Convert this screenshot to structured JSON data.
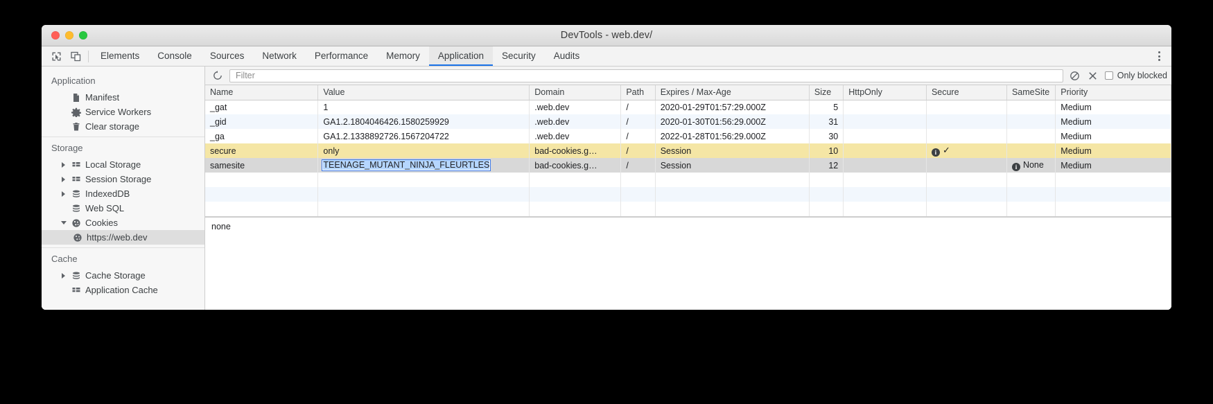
{
  "window": {
    "title": "DevTools - web.dev/",
    "traffic_lights": [
      "close",
      "minimize",
      "maximize"
    ]
  },
  "tabstrip": {
    "icons": [
      "inspect-element-icon",
      "device-toolbar-icon"
    ],
    "tabs": [
      {
        "label": "Elements",
        "active": false
      },
      {
        "label": "Console",
        "active": false
      },
      {
        "label": "Sources",
        "active": false
      },
      {
        "label": "Network",
        "active": false
      },
      {
        "label": "Performance",
        "active": false
      },
      {
        "label": "Memory",
        "active": false
      },
      {
        "label": "Application",
        "active": true
      },
      {
        "label": "Security",
        "active": false
      },
      {
        "label": "Audits",
        "active": false
      }
    ],
    "more_label": "more-options"
  },
  "sidebar": {
    "sections": [
      {
        "title": "Application",
        "items": [
          {
            "label": "Manifest",
            "icon": "document-icon",
            "twisty": "none",
            "indent": 1,
            "selected": false
          },
          {
            "label": "Service Workers",
            "icon": "gear-icon",
            "twisty": "none",
            "indent": 1,
            "selected": false
          },
          {
            "label": "Clear storage",
            "icon": "trash-icon",
            "twisty": "none",
            "indent": 1,
            "selected": false
          }
        ]
      },
      {
        "title": "Storage",
        "items": [
          {
            "label": "Local Storage",
            "icon": "table-icon",
            "twisty": "closed",
            "indent": 1,
            "selected": false
          },
          {
            "label": "Session Storage",
            "icon": "table-icon",
            "twisty": "closed",
            "indent": 1,
            "selected": false
          },
          {
            "label": "IndexedDB",
            "icon": "database-icon",
            "twisty": "closed",
            "indent": 1,
            "selected": false
          },
          {
            "label": "Web SQL",
            "icon": "database-icon",
            "twisty": "none",
            "indent": 1,
            "selected": false
          },
          {
            "label": "Cookies",
            "icon": "cookie-icon",
            "twisty": "open",
            "indent": 1,
            "selected": false
          },
          {
            "label": "https://web.dev",
            "icon": "cookie-icon",
            "twisty": "none",
            "indent": 2,
            "selected": true
          }
        ]
      },
      {
        "title": "Cache",
        "items": [
          {
            "label": "Cache Storage",
            "icon": "database-icon",
            "twisty": "closed",
            "indent": 1,
            "selected": false
          },
          {
            "label": "Application Cache",
            "icon": "table-icon",
            "twisty": "none",
            "indent": 1,
            "selected": false
          }
        ]
      }
    ]
  },
  "toolbar": {
    "refresh_icon": "refresh-icon",
    "filter_placeholder": "Filter",
    "filter_value": "",
    "clear_filter_icon": "block-icon",
    "delete_icon": "close-x-icon",
    "only_blocked_label": "Only blocked",
    "only_blocked_checked": false
  },
  "table": {
    "columns": [
      "Name",
      "Value",
      "Domain",
      "Path",
      "Expires / Max-Age",
      "Size",
      "HttpOnly",
      "Secure",
      "SameSite",
      "Priority"
    ],
    "rows": [
      {
        "name": "_gat",
        "value": "1",
        "domain": ".web.dev",
        "path": "/",
        "expires": "2020-01-29T01:57:29.000Z",
        "size": "5",
        "httponly": "",
        "secure": "",
        "samesite": "",
        "priority": "Medium",
        "style": "odd"
      },
      {
        "name": "_gid",
        "value": "GA1.2.1804046426.1580259929",
        "domain": ".web.dev",
        "path": "/",
        "expires": "2020-01-30T01:56:29.000Z",
        "size": "31",
        "httponly": "",
        "secure": "",
        "samesite": "",
        "priority": "Medium",
        "style": "even"
      },
      {
        "name": "_ga",
        "value": "GA1.2.1338892726.1567204722",
        "domain": ".web.dev",
        "path": "/",
        "expires": "2022-01-28T01:56:29.000Z",
        "size": "30",
        "httponly": "",
        "secure": "",
        "samesite": "",
        "priority": "Medium",
        "style": "odd"
      },
      {
        "name": "secure",
        "value": "only",
        "domain": "bad-cookies.g…",
        "path": "/",
        "expires": "Session",
        "size": "10",
        "httponly": "",
        "secure": "✓",
        "secure_info": true,
        "samesite": "",
        "priority": "Medium",
        "style": "warn"
      },
      {
        "name": "samesite",
        "value": "TEENAGE_MUTANT_NINJA_FLEURTLES",
        "value_editing": true,
        "domain": "bad-cookies.g…",
        "path": "/",
        "expires": "Session",
        "size": "12",
        "httponly": "",
        "secure": "",
        "samesite": "None",
        "samesite_info": true,
        "priority": "Medium",
        "style": "selected"
      }
    ],
    "empty_rows": 2
  },
  "preview": {
    "text": "none"
  },
  "colors": {
    "accent": "#1a73e8",
    "warn_row": "#f5e6a5",
    "selected_row": "#d8d8d8",
    "alt_row": "#f2f7fd",
    "selection_highlight": "#b5d6fe"
  }
}
